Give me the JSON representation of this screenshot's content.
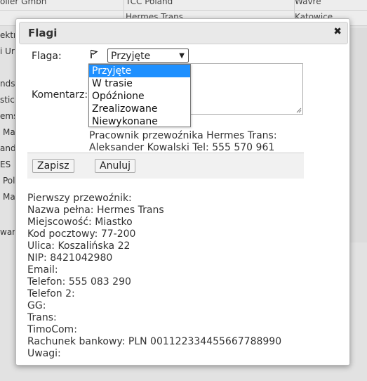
{
  "background": {
    "row0": [
      "oller Gmbh",
      "TCC Poland",
      "Wavre"
    ],
    "row1": [
      "",
      "Hermes Trans",
      "Katowice"
    ],
    "side_fragments": [
      "ektr",
      "i Ur",
      "nds",
      "stic",
      "ems",
      "Ma",
      "and",
      "ES",
      "Pol",
      "Ma",
      "war"
    ]
  },
  "dialog": {
    "title": "Flagi",
    "close_icon": "close-icon",
    "flag_label": "Flaga:",
    "flag_icon": "flag-icon",
    "selected": "Przyjęte",
    "options": [
      "Przyjęte",
      "W trasie",
      "Opóźnione",
      "Zrealizowane",
      "Niewykonane"
    ],
    "comment_label": "Komentarz:",
    "comment_value": "",
    "worker_line1": "Pracownik przewoźnika Hermes Trans:",
    "worker_line2": "Aleksander Kowalski Tel: 555 570 961",
    "save_label": "Zapisz",
    "cancel_label": "Anuluj",
    "info": [
      "Pierwszy przewoźnik:",
      "Nazwa pełna: Hermes Trans",
      "Miejscowość: Miastko",
      "Kod pocztowy: 77-200",
      "Ulica: Koszalińska 22",
      "NIP: 8421042980",
      "Email:",
      "Telefon: 555 083 290",
      "Telefon 2:",
      "GG:",
      "Trans:",
      "TimoCom:",
      "Rachunek bankowy: PLN 0011223344556677889​90",
      "Uwagi:"
    ]
  },
  "colors": {
    "accent": "#1e90ff",
    "titlebar": "#e9e9e9"
  }
}
